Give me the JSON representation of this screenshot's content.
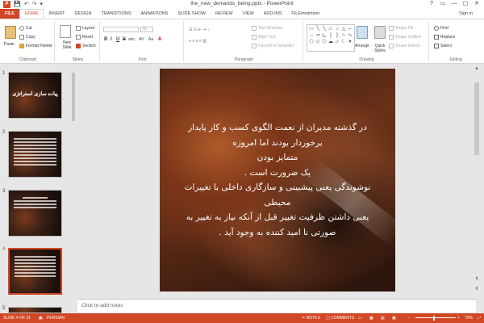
{
  "window": {
    "title": "the_new_demands_being.pptx - PowerPoint",
    "controls": [
      "?",
      "▭",
      "—",
      "▢",
      "✕"
    ]
  },
  "qat": {
    "save": "💾",
    "undo": "↶",
    "redo": "↷",
    "customize": "▾"
  },
  "tabs": [
    {
      "label": "FILE"
    },
    {
      "label": "HOME"
    },
    {
      "label": "INSERT"
    },
    {
      "label": "DESIGN"
    },
    {
      "label": "TRANSITIONS"
    },
    {
      "label": "ANIMATIONS"
    },
    {
      "label": "SLIDE SHOW"
    },
    {
      "label": "REVIEW"
    },
    {
      "label": "VIEW"
    },
    {
      "label": "ADD-INS"
    },
    {
      "label": "FILEminimizer"
    }
  ],
  "active_tab": "HOME",
  "signin": "Sign in",
  "ribbon": {
    "clipboard": {
      "label": "Clipboard",
      "paste": "Paste",
      "cut": "Cut",
      "copy": "Copy",
      "format_painter": "Format Painter"
    },
    "slides": {
      "label": "Slides",
      "new_slide": "New Slide",
      "layout": "Layout",
      "reset": "Reset",
      "section": "Section"
    },
    "font": {
      "label": "Font",
      "size_value": "72",
      "bold": "B",
      "italic": "I",
      "underline": "U",
      "strike": "S",
      "shadow": "abc",
      "spacing": "AV",
      "case": "Aa",
      "color": "A"
    },
    "paragraph": {
      "label": "Paragraph",
      "text_direction": "Text Direction",
      "align_text": "Align Text",
      "smartart": "Convert to SmartArt"
    },
    "drawing": {
      "label": "Drawing",
      "arrange": "Arrange",
      "quick_styles": "Quick Styles",
      "shape_fill": "Shape Fill",
      "shape_outline": "Shape Outline",
      "shape_effects": "Shape Effects"
    },
    "editing": {
      "label": "Editing",
      "find": "Find",
      "replace": "Replace",
      "select": "Select"
    }
  },
  "thumbnails": [
    {
      "num": "1",
      "title": "پیاده سازی استراتژی"
    },
    {
      "num": "2",
      "title": ""
    },
    {
      "num": "3",
      "title": ""
    },
    {
      "num": "4",
      "title": ""
    },
    {
      "num": "5",
      "title": ""
    }
  ],
  "slide": {
    "lines": [
      "در گذشته مدیران از نعمت الگوی کسب و کار پایدار",
      "برخوردار بودند اما امروزه",
      "متمایز بودن",
      "یک ضرورت است .",
      "نوشوندگی یعنی پیشبینی و سازگاری داخلی با تغییرات",
      "محیطی",
      "یعنی داشتن ظرفیت تغییر قبل از آنکه نیاز به تغییر به",
      "صورتی نا امید کننده به وجود آید ."
    ]
  },
  "notes_placeholder": "Click to add notes",
  "status": {
    "slide_info": "SLIDE 4 OF 21",
    "language": "PERSIAN",
    "notes": "NOTES",
    "comments": "COMMENTS",
    "zoom": "70%"
  },
  "colors": {
    "accent": "#d24726",
    "background": "#e6e6e6"
  }
}
